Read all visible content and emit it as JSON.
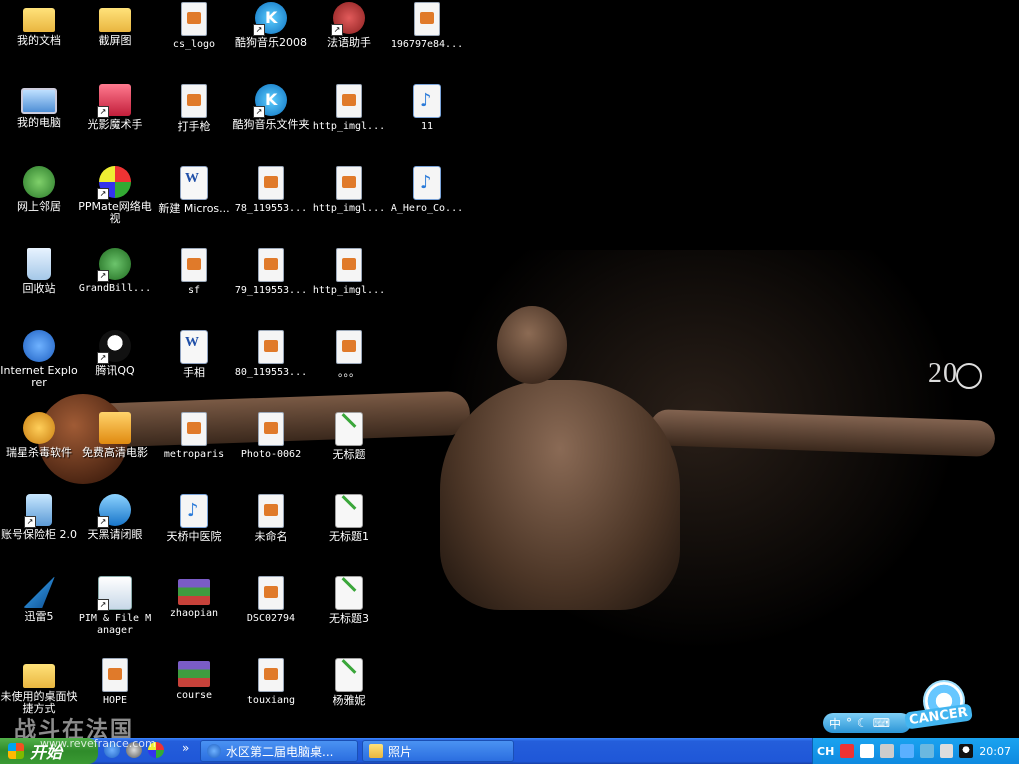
{
  "desktop": {
    "icons": [
      {
        "label": "我的文档",
        "type": "folder"
      },
      {
        "label": "截屏图",
        "type": "folder"
      },
      {
        "label": "cs_logo",
        "type": "doc"
      },
      {
        "label": "酷狗音乐2008",
        "type": "kugou"
      },
      {
        "label": "法语助手",
        "type": "french"
      },
      {
        "label": "196797e84...",
        "type": "doc"
      },
      {
        "label": "我的电脑",
        "type": "computer"
      },
      {
        "label": "光影魔术手",
        "type": "app-red"
      },
      {
        "label": "打手枪",
        "type": "doc"
      },
      {
        "label": "酷狗音乐文件夹",
        "type": "kugou"
      },
      {
        "label": "http_imgl...",
        "type": "doc"
      },
      {
        "label": "11",
        "type": "mp3"
      },
      {
        "label": "网上邻居",
        "type": "network"
      },
      {
        "label": "PPMate网络电视",
        "type": "ppmate"
      },
      {
        "label": "新建 Micros...",
        "type": "word"
      },
      {
        "label": "78_119553...",
        "type": "doc"
      },
      {
        "label": "http_imgl...",
        "type": "doc"
      },
      {
        "label": "A_Hero_Co...",
        "type": "mp3"
      },
      {
        "label": "回收站",
        "type": "recycle"
      },
      {
        "label": "GrandBill...",
        "type": "app-green"
      },
      {
        "label": "sf",
        "type": "doc"
      },
      {
        "label": "79_119553...",
        "type": "doc"
      },
      {
        "label": "http_imgl...",
        "type": "doc"
      },
      {
        "label": "Internet Explorer",
        "type": "ie"
      },
      {
        "label": "腾讯QQ",
        "type": "qq"
      },
      {
        "label": "手相",
        "type": "word"
      },
      {
        "label": "80_119553...",
        "type": "doc"
      },
      {
        "label": "。。。",
        "type": "doc"
      },
      {
        "label": "瑞星杀毒软件",
        "type": "lion"
      },
      {
        "label": "免费高清电影",
        "type": "app-orange"
      },
      {
        "label": "metroparis",
        "type": "doc"
      },
      {
        "label": "Photo-0062",
        "type": "doc"
      },
      {
        "label": "无标题",
        "type": "paint"
      },
      {
        "label": "账号保险柜 2.0",
        "type": "shield"
      },
      {
        "label": "天黑请闭眼",
        "type": "app-blue"
      },
      {
        "label": "天桥中医院",
        "type": "mp3"
      },
      {
        "label": "未命名",
        "type": "doc"
      },
      {
        "label": "无标题1",
        "type": "paint"
      },
      {
        "label": "迅雷5",
        "type": "xunlei"
      },
      {
        "label": "PIM & File Manager",
        "type": "pim"
      },
      {
        "label": "zhaopian",
        "type": "rar"
      },
      {
        "label": "DSC02794",
        "type": "doc"
      },
      {
        "label": "无标题3",
        "type": "paint"
      },
      {
        "label": "未使用的桌面快捷方式",
        "type": "folder"
      },
      {
        "label": "HOPE",
        "type": "doc"
      },
      {
        "label": "course",
        "type": "rar"
      },
      {
        "label": "touxiang",
        "type": "doc"
      },
      {
        "label": "杨雅妮",
        "type": "paint"
      }
    ]
  },
  "wallpaper": {
    "logo_text": "20"
  },
  "ime": {
    "label": "中"
  },
  "cancer": {
    "text": "CANCER"
  },
  "watermark": {
    "text": "战斗在法国",
    "url": "www.revefrance.com"
  },
  "taskbar": {
    "start_label": "开始",
    "tasks": [
      {
        "label": "水区第二届电脑桌...",
        "icon": "ie-icon"
      },
      {
        "label": "照片",
        "icon": "folder-icon"
      }
    ],
    "tray": {
      "lang": "CH",
      "time": "20:07"
    }
  }
}
